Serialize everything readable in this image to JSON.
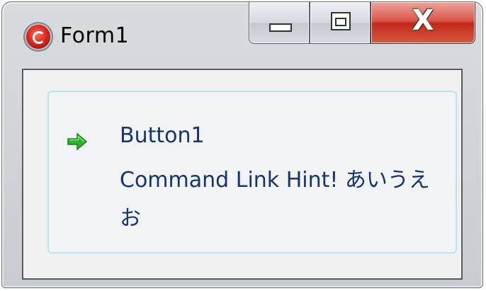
{
  "window": {
    "title": "Form1",
    "icon": "app-red-icon"
  },
  "caption_buttons": {
    "minimize_icon": "minimize-icon",
    "maximize_icon": "maximize-icon",
    "close_glyph": "X"
  },
  "command_link": {
    "icon": "green-arrow-icon",
    "title": "Button1",
    "hint": "Command Link Hint! あいうえお"
  }
}
